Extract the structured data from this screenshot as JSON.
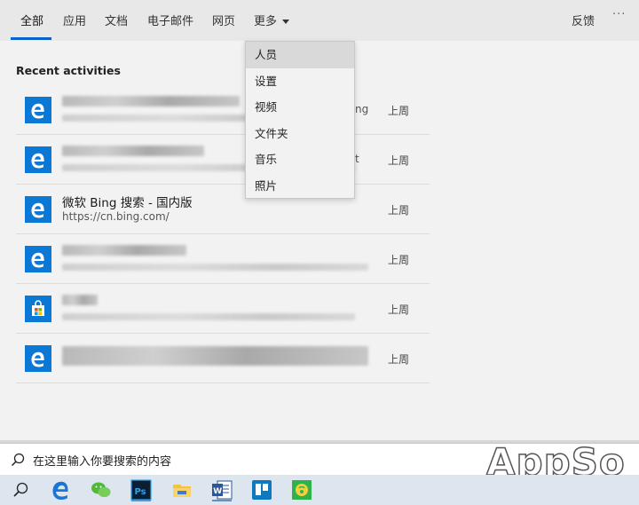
{
  "tabs": [
    {
      "label": "全部",
      "active": true
    },
    {
      "label": "应用"
    },
    {
      "label": "文档"
    },
    {
      "label": "电子邮件"
    },
    {
      "label": "网页"
    },
    {
      "label": "更多"
    }
  ],
  "header": {
    "feedback": "反馈",
    "more_options": "···"
  },
  "recent": {
    "title": "Recent activities",
    "items": [
      {
        "app": "edge-icon",
        "title": "",
        "url": "",
        "trail": "ng",
        "when": "上周"
      },
      {
        "app": "edge-icon",
        "title": "",
        "url": "",
        "trail": "t",
        "when": "上周"
      },
      {
        "app": "edge-icon",
        "title": "微软 Bing 搜索 - 国内版",
        "url": "https://cn.bing.com/",
        "trail": "",
        "when": "上周"
      },
      {
        "app": "edge-icon",
        "title": "",
        "url": "",
        "trail": "",
        "when": "上周"
      },
      {
        "app": "store-icon",
        "title": "",
        "url": "",
        "trail": "",
        "when": "上周"
      },
      {
        "app": "edge-icon",
        "title": "",
        "url": "",
        "trail": "",
        "when": "上周"
      }
    ]
  },
  "dropdown": {
    "items": [
      "人员",
      "设置",
      "视频",
      "文件夹",
      "音乐",
      "照片"
    ],
    "highlighted": "人员"
  },
  "search": {
    "placeholder": "在这里输入你要搜索的内容"
  },
  "watermark": "AppSo",
  "taskbar": {
    "icons": [
      "search-icon",
      "edge-icon",
      "wechat-icon",
      "photoshop-icon",
      "file-explorer-icon",
      "word-icon",
      "trello-icon",
      "green-app-icon"
    ]
  },
  "colors": {
    "accent": "#0a62c9",
    "edge_blue": "#0a78d4"
  }
}
